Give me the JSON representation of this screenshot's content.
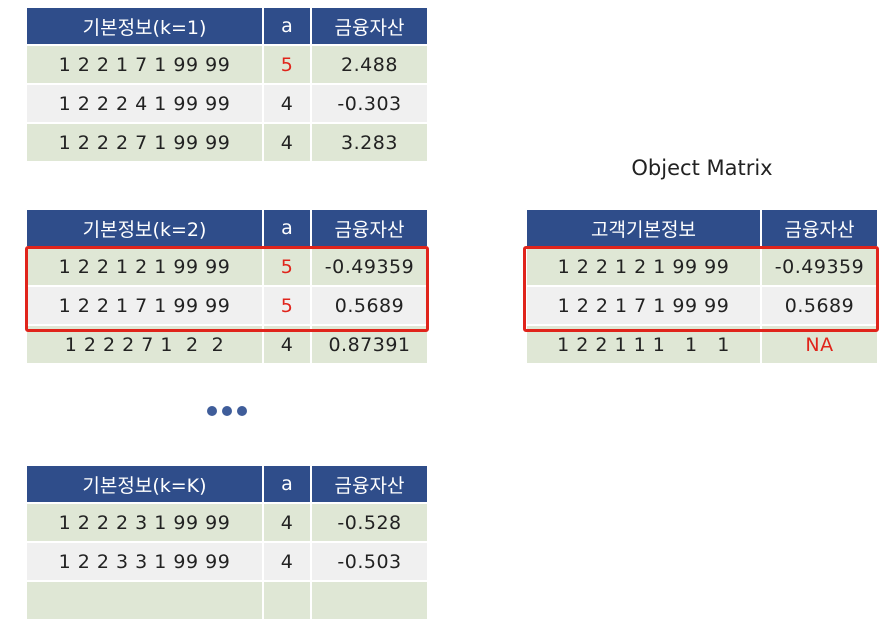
{
  "colors": {
    "header_bg": "#2f4d8a",
    "row_green": "#dfe7d5",
    "row_light": "#f0f0f0",
    "highlight": "#e0241b"
  },
  "table1": {
    "headers": [
      "기본정보(k=1)",
      "a",
      "금융자산"
    ],
    "rows": [
      [
        "1 2 2 1 7 1 99 99",
        "5",
        "2.488"
      ],
      [
        "1 2 2 2 4 1 99 99",
        "4",
        "-0.303"
      ],
      [
        "1 2 2 2 7 1 99 99",
        "4",
        "3.283"
      ]
    ]
  },
  "table2": {
    "headers": [
      "기본정보(k=2)",
      "a",
      "금융자산"
    ],
    "rows": [
      [
        "1 2 2 1 2 1 99 99",
        "5",
        "-0.49359"
      ],
      [
        "1 2 2 1 7 1 99 99",
        "5",
        "0.5689"
      ],
      [
        "1 2 2 2 7 1  2  2",
        "4",
        "0.87391"
      ]
    ]
  },
  "table3": {
    "headers": [
      "기본정보(k=K)",
      "a",
      "금융자산"
    ],
    "rows": [
      [
        "1 2 2 2 3 1 99 99",
        "4",
        "-0.528"
      ],
      [
        "1 2 2 3 3 1 99 99",
        "4",
        "-0.503"
      ],
      [
        "",
        "",
        ""
      ]
    ]
  },
  "object_matrix": {
    "title": "Object Matrix",
    "headers": [
      "고객기본정보",
      "금융자산"
    ],
    "rows": [
      [
        "1 2 2 1 2 1 99 99",
        "-0.49359"
      ],
      [
        "1 2 2 1 7 1 99 99",
        "0.5689"
      ],
      [
        "1 2 2 1 1 1   1   1",
        "NA"
      ]
    ]
  },
  "ellipsis_icon": "three-dots"
}
